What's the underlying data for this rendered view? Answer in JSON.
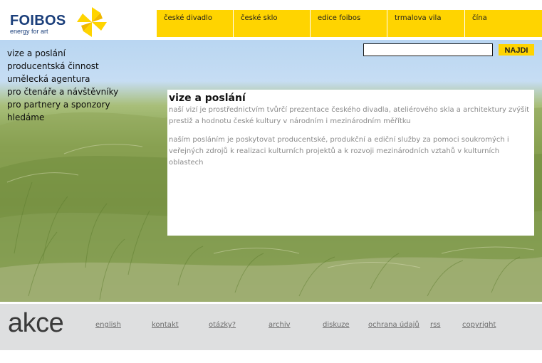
{
  "logo": {
    "name": "FOIBOS",
    "tagline": "energy for art"
  },
  "colors": {
    "accent": "#ffd400",
    "brand_blue": "#1a3e7a",
    "footer_bg": "#dedfe0"
  },
  "topnav": [
    {
      "label": "české divadlo"
    },
    {
      "label": "české sklo"
    },
    {
      "label": "edice foibos"
    },
    {
      "label": "trmalova vila"
    },
    {
      "label": "čína"
    }
  ],
  "sidenav": [
    {
      "label": "vize a poslání"
    },
    {
      "label": "producentská činnost"
    },
    {
      "label": "umělecká agentura"
    },
    {
      "label": "pro čtenáře a návštěvníky"
    },
    {
      "label": "pro partnery a sponzory"
    },
    {
      "label": "hledáme"
    }
  ],
  "search": {
    "value": "",
    "button_label": "NAJDI"
  },
  "content": {
    "title": "vize a poslání",
    "paragraphs": [
      "naší vizí je prostřednictvím tvůrčí prezentace českého divadla, ateliérového skla a architektury zvýšit prestiž a hodnotu české kultury v národním i mezinárodním měřítku",
      "naším posláním je poskytovat producentské, produkční a ediční služby za pomoci soukromých i veřejných zdrojů k realizaci kulturních projektů a k rozvoji mezinárodních vztahů v kulturních oblastech"
    ]
  },
  "footer": {
    "heading": "akce",
    "links": [
      {
        "label": "english"
      },
      {
        "label": "kontakt"
      },
      {
        "label": "otázky?"
      },
      {
        "label": "archiv"
      },
      {
        "label": "diskuze"
      },
      {
        "label": "ochrana údajů"
      },
      {
        "label": "rss"
      },
      {
        "label": "copyright"
      }
    ]
  }
}
